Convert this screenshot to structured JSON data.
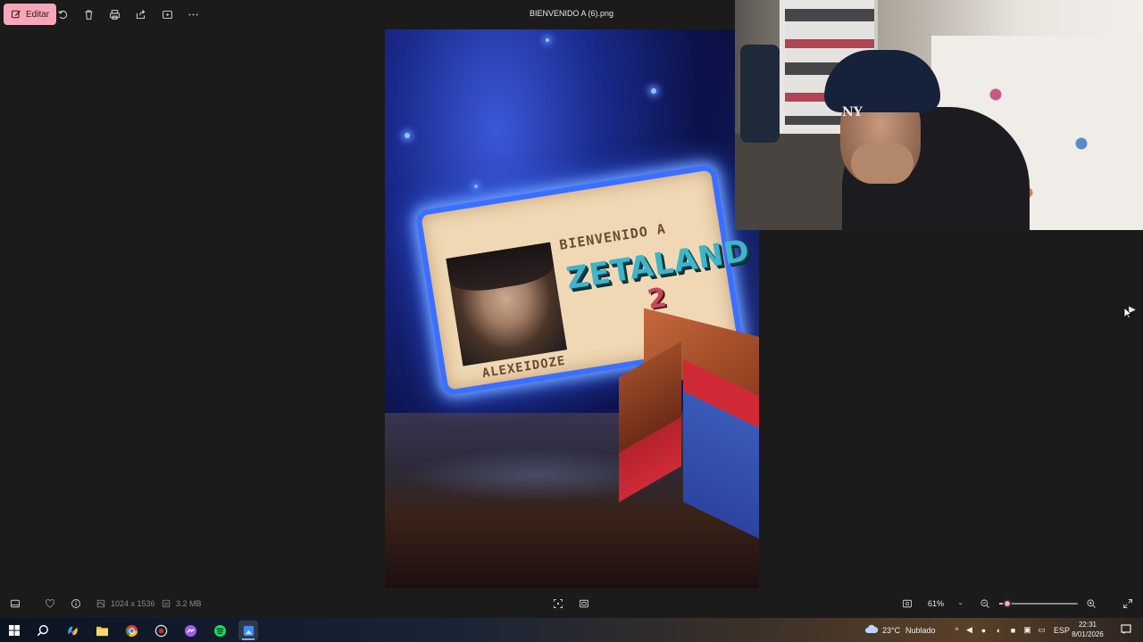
{
  "toolbar": {
    "edit_label": "Editar",
    "file_title": "BIENVENIDO A (6).png"
  },
  "artwork": {
    "welcome_text": "BIENVENIDO A",
    "logo_text": "ZETALAND",
    "logo_number": "2",
    "name_text": "ALEXEIDOZE"
  },
  "webcam": {
    "cap_logo": "NY"
  },
  "statusbar": {
    "dimensions": "1024 x 1536",
    "file_size": "3.2 MB",
    "zoom_level": "61%",
    "zoom_slider_fraction": 0.1
  },
  "taskbar": {
    "weather_temp": "23°C",
    "weather_condition": "Nublado",
    "language": "ESP",
    "time": "22:31",
    "date": "8/01/2026"
  },
  "colors": {
    "accent": "#f7a8b8",
    "background": "#1b1b1b"
  }
}
